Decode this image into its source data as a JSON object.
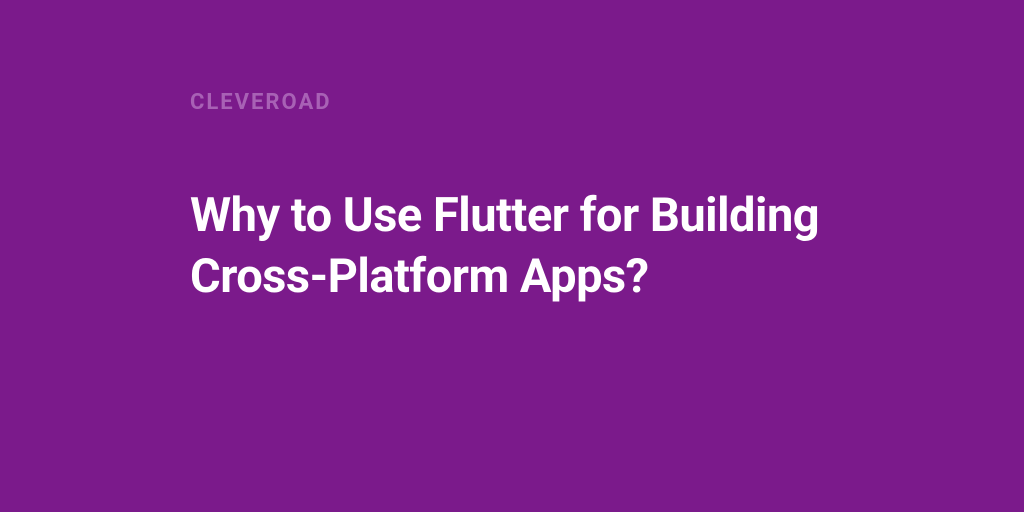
{
  "brand": "CLEVEROAD",
  "title": "Why to Use Flutter for Building Cross-Platform Apps?",
  "colors": {
    "background": "#7b1a8b",
    "brand_text": "#a861b5",
    "title_text": "#ffffff"
  }
}
